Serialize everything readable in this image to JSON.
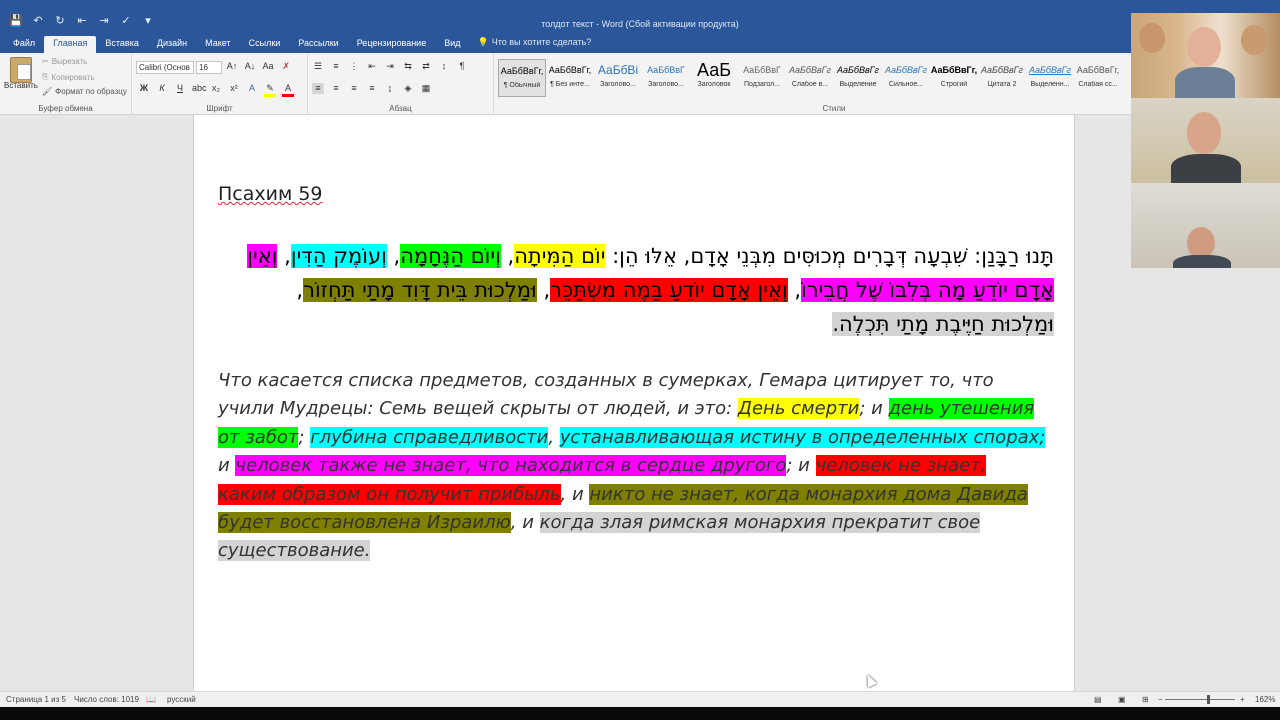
{
  "window": {
    "title": "толдот текст  -  Word (Сбой активации продукта)"
  },
  "tabs": [
    "Файл",
    "Главная",
    "Вставка",
    "Дизайн",
    "Макет",
    "Ссылки",
    "Рассылки",
    "Рецензирование",
    "Вид"
  ],
  "tell_me": "Что вы хотите сделать?",
  "clipboard": {
    "paste": "Вставить",
    "cut": "Вырезать",
    "copy": "Копировать",
    "format_painter": "Формат по образцу",
    "group_label": "Буфер обмена"
  },
  "font": {
    "name": "Calibri (Основ",
    "size": "16",
    "group_label": "Шрифт"
  },
  "paragraph": {
    "group_label": "Абзац"
  },
  "styles": {
    "group_label": "Стили",
    "items": [
      {
        "preview": "АаБбВвГг,",
        "name": "¶ Обычный"
      },
      {
        "preview": "АаБбВвГг,",
        "name": "¶ Без инте..."
      },
      {
        "preview": "АаБбВі",
        "name": "Заголово..."
      },
      {
        "preview": "АаБбВвГ",
        "name": "Заголово..."
      },
      {
        "preview": "АаБ",
        "name": "Заголовок"
      },
      {
        "preview": "АаБбВвГ",
        "name": "Подзагол..."
      },
      {
        "preview": "АаБбВвГг",
        "name": "Слабое в..."
      },
      {
        "preview": "АаБбВвГг",
        "name": "Выделение"
      },
      {
        "preview": "АаБбВвГг",
        "name": "Сильное..."
      },
      {
        "preview": "АаБбВвГг,",
        "name": "Строгий"
      },
      {
        "preview": "АаБбВвГг",
        "name": "Цитата 2"
      },
      {
        "preview": "АаБбВвГг",
        "name": "Выделенн..."
      },
      {
        "preview": "АаБбВвГг,",
        "name": "Слабая сс..."
      }
    ]
  },
  "document": {
    "heading": "Псахим 59",
    "hebrew": [
      {
        "text": "תָּנוּ רַבָּנַן: שִׁבְעָה דְּבָרִים מְכוּסִּים מִבְּנֵי אָדָם, אֵלּוּ הֵן: ",
        "hl": ""
      },
      {
        "text": "יוֹם הַמִּיתָה",
        "hl": "yellow"
      },
      {
        "text": ", ",
        "hl": ""
      },
      {
        "text": "וְיוֹם הַנֶּחָמָה",
        "hl": "green"
      },
      {
        "text": ", ",
        "hl": ""
      },
      {
        "text": "וְעוֹמֶק הַדִּין",
        "hl": "cyan"
      },
      {
        "text": ", ",
        "hl": ""
      },
      {
        "text": "וְאֵין אָדָם יוֹדֵעַ מָה בְּלִבּוֹ שֶׁל חֲבֵירוֹ",
        "hl": "magenta"
      },
      {
        "text": ", ",
        "hl": ""
      },
      {
        "text": "וְאֵין אָדָם יוֹדֵעַ בַּמֶּה מִשְׂתַּכֵּר",
        "hl": "red"
      },
      {
        "text": ", ",
        "hl": ""
      },
      {
        "text": "וּמַלְכוּת בֵּית דָּוִד מָתַי תַּחְזוֹר",
        "hl": "olive"
      },
      {
        "text": ", ",
        "hl": ""
      },
      {
        "text": "וּמַלְכוּת חַיֶּיבֶת מָתַי תִּכְלֶה.",
        "hl": "gray"
      }
    ],
    "russian": [
      {
        "text": "Что касается списка предметов, созданных в сумерках, Гемара цитирует то, что учили Мудрецы: Семь вещей скрыты от людей, и это: ",
        "hl": ""
      },
      {
        "text": "День смерти",
        "hl": "yellow"
      },
      {
        "text": "; и ",
        "hl": ""
      },
      {
        "text": "день утешения от забот",
        "hl": "green"
      },
      {
        "text": "; ",
        "hl": ""
      },
      {
        "text": "глубина справедливости",
        "hl": "cyan"
      },
      {
        "text": ", ",
        "hl": ""
      },
      {
        "text": "устанавливающая истину в определенных спорах;",
        "hl": "cyan"
      },
      {
        "text": " и ",
        "hl": ""
      },
      {
        "text": "человек также не знает, что находится в сердце другого",
        "hl": "magenta"
      },
      {
        "text": "; и ",
        "hl": ""
      },
      {
        "text": "человек не знает, каким образом он получит прибыль",
        "hl": "red"
      },
      {
        "text": ", и ",
        "hl": ""
      },
      {
        "text": "никто не знает, когда монархия дома Давида будет восстановлена Израилю",
        "hl": "olive"
      },
      {
        "text": ", и ",
        "hl": ""
      },
      {
        "text": "когда злая римская монархия прекратит свое существование.",
        "hl": "gray"
      }
    ]
  },
  "status": {
    "page": "Страница 1 из 5",
    "words": "Число слов: 1019",
    "language": "русский",
    "zoom": "162%"
  }
}
